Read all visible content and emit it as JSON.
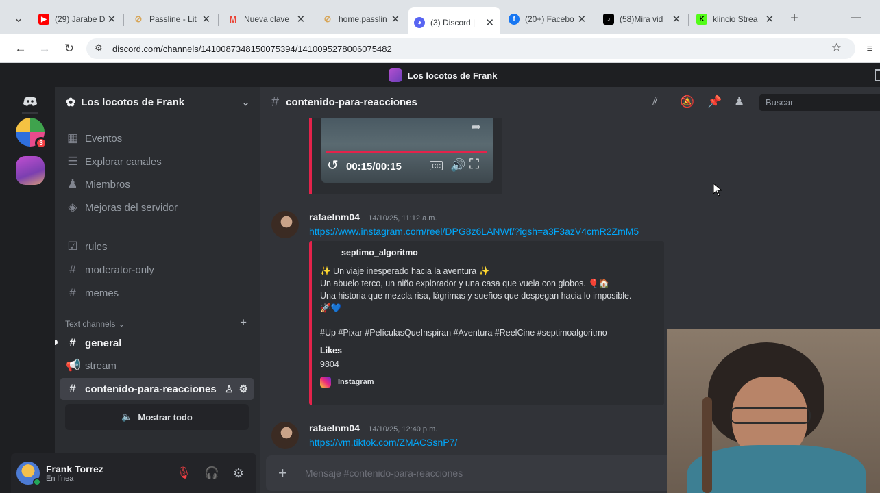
{
  "browser": {
    "tabs": [
      {
        "title": "(29) Jarabe D",
        "icon": "youtube-icon",
        "color": "#ff0000"
      },
      {
        "title": "Passline - Lit",
        "icon": "link-icon",
        "color": "#d7a659"
      },
      {
        "title": "Nueva clave",
        "icon": "gmail-icon",
        "color": "#ea4335"
      },
      {
        "title": "home.passlin",
        "icon": "link-icon",
        "color": "#d7a659"
      },
      {
        "title": "(3) Discord |",
        "icon": "discord-icon",
        "color": "#5865f2",
        "active": true
      },
      {
        "title": "(20+) Facebo",
        "icon": "facebook-icon",
        "color": "#1877f2"
      },
      {
        "title": "(58)Mira vid",
        "icon": "tiktok-icon",
        "color": "#000000"
      },
      {
        "title": "klincio Strea",
        "icon": "kick-icon",
        "color": "#53fc18"
      }
    ],
    "url": "discord.com/channels/1410087348150075394/1410095278006075482"
  },
  "window": {
    "title": "Los locotos de Frank"
  },
  "server": {
    "name": "Los locotos de Frank",
    "badge": "3",
    "menu": [
      {
        "label": "Eventos",
        "icon": "calendar-icon"
      },
      {
        "label": "Explorar canales",
        "icon": "browse-channels-icon"
      },
      {
        "label": "Miembros",
        "icon": "members-icon"
      },
      {
        "label": "Mejoras del servidor",
        "icon": "boost-icon"
      }
    ],
    "channels_top": [
      {
        "label": "rules",
        "icon": "rules-icon"
      },
      {
        "label": "moderator-only",
        "icon": "hash-icon"
      },
      {
        "label": "memes",
        "icon": "hash-icon"
      }
    ],
    "category": "Text channels",
    "channels": [
      {
        "label": "general",
        "icon": "hash-icon"
      },
      {
        "label": "stream",
        "icon": "megaphone-icon"
      },
      {
        "label": "contenido-para-reacciones",
        "icon": "hash-icon"
      }
    ],
    "show_all": "Mostrar todo"
  },
  "user": {
    "name": "Frank Torrez",
    "status": "En línea"
  },
  "channel": {
    "name": "contenido-para-reacciones",
    "search_placeholder": "Buscar",
    "composer_placeholder": "Mensaje #contenido-para-reacciones"
  },
  "video": {
    "time": "00:15/00:15",
    "progress": 1.0
  },
  "messages": [
    {
      "author": "rafaelnm04",
      "time": "14/10/25, 11:12 a.m.",
      "link": "https://www.instagram.com/reel/DPG8z6LANWf/?igsh=a3F3azV4cmR2ZmM5",
      "embed": {
        "author": "septimo_algoritmo",
        "line1": "✨ Un viaje inesperado hacia la aventura ✨",
        "line2": "Un abuelo terco, un niño explorador y una casa que vuela con globos. 🎈🏠",
        "line3": "Una historia que mezcla risa, lágrimas y sueños que despegan hacia lo imposible.",
        "line4": "🚀💙",
        "tags": "#Up #Pixar #PelículasQueInspiran #Aventura #ReelCine #septimoalgoritmo",
        "field_name": "Likes",
        "field_value": "9804",
        "provider": "Instagram"
      }
    },
    {
      "author": "rafaelnm04",
      "time": "14/10/25, 12:40 p.m.",
      "link": "https://vm.tiktok.com/ZMACSsnP7/"
    }
  ]
}
